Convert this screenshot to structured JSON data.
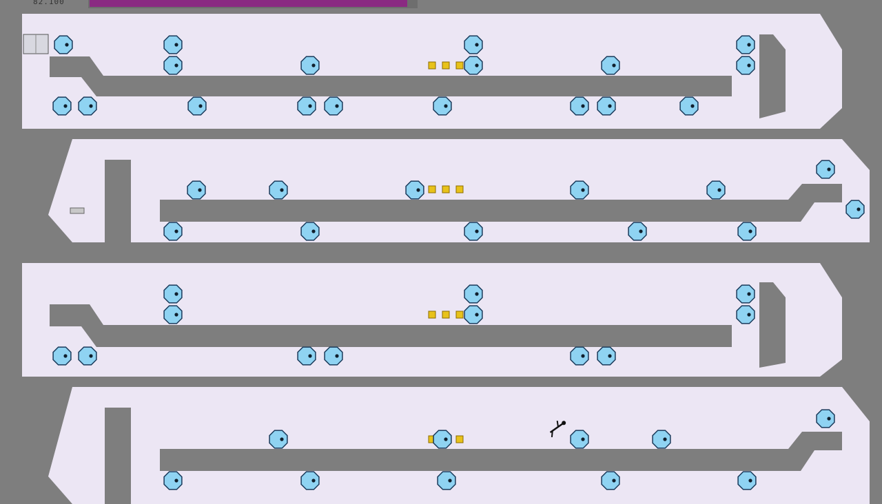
{
  "hud": {
    "time_label": "82.100",
    "time_fraction": 0.98
  },
  "colors": {
    "background": "#7e7e7e",
    "floor": "#ece6f4",
    "wall": "#7e7e7e",
    "drone": "#8fd3f2",
    "drone_outline": "#1a3a5a",
    "gold": "#e8c21a",
    "time_bar": "#8a2a82"
  },
  "icons": {
    "drone": "zap-drone-icon",
    "gold": "gold-icon",
    "player": "ninja-icon",
    "exit_door": "exit-door-icon",
    "switch": "exit-switch-icon"
  }
}
